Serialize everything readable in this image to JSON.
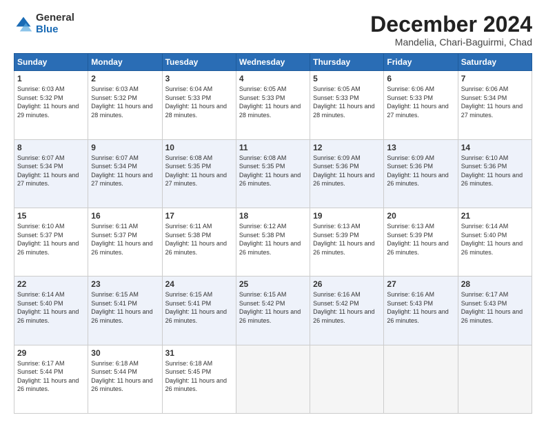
{
  "logo": {
    "general": "General",
    "blue": "Blue"
  },
  "title": "December 2024",
  "location": "Mandelia, Chari-Baguirmi, Chad",
  "days_of_week": [
    "Sunday",
    "Monday",
    "Tuesday",
    "Wednesday",
    "Thursday",
    "Friday",
    "Saturday"
  ],
  "weeks": [
    [
      {
        "day": "1",
        "rise": "6:03 AM",
        "set": "5:32 PM",
        "daylight": "11 hours and 29 minutes."
      },
      {
        "day": "2",
        "rise": "6:03 AM",
        "set": "5:32 PM",
        "daylight": "11 hours and 28 minutes."
      },
      {
        "day": "3",
        "rise": "6:04 AM",
        "set": "5:33 PM",
        "daylight": "11 hours and 28 minutes."
      },
      {
        "day": "4",
        "rise": "6:05 AM",
        "set": "5:33 PM",
        "daylight": "11 hours and 28 minutes."
      },
      {
        "day": "5",
        "rise": "6:05 AM",
        "set": "5:33 PM",
        "daylight": "11 hours and 28 minutes."
      },
      {
        "day": "6",
        "rise": "6:06 AM",
        "set": "5:33 PM",
        "daylight": "11 hours and 27 minutes."
      },
      {
        "day": "7",
        "rise": "6:06 AM",
        "set": "5:34 PM",
        "daylight": "11 hours and 27 minutes."
      }
    ],
    [
      {
        "day": "8",
        "rise": "6:07 AM",
        "set": "5:34 PM",
        "daylight": "11 hours and 27 minutes."
      },
      {
        "day": "9",
        "rise": "6:07 AM",
        "set": "5:34 PM",
        "daylight": "11 hours and 27 minutes."
      },
      {
        "day": "10",
        "rise": "6:08 AM",
        "set": "5:35 PM",
        "daylight": "11 hours and 27 minutes."
      },
      {
        "day": "11",
        "rise": "6:08 AM",
        "set": "5:35 PM",
        "daylight": "11 hours and 26 minutes."
      },
      {
        "day": "12",
        "rise": "6:09 AM",
        "set": "5:36 PM",
        "daylight": "11 hours and 26 minutes."
      },
      {
        "day": "13",
        "rise": "6:09 AM",
        "set": "5:36 PM",
        "daylight": "11 hours and 26 minutes."
      },
      {
        "day": "14",
        "rise": "6:10 AM",
        "set": "5:36 PM",
        "daylight": "11 hours and 26 minutes."
      }
    ],
    [
      {
        "day": "15",
        "rise": "6:10 AM",
        "set": "5:37 PM",
        "daylight": "11 hours and 26 minutes."
      },
      {
        "day": "16",
        "rise": "6:11 AM",
        "set": "5:37 PM",
        "daylight": "11 hours and 26 minutes."
      },
      {
        "day": "17",
        "rise": "6:11 AM",
        "set": "5:38 PM",
        "daylight": "11 hours and 26 minutes."
      },
      {
        "day": "18",
        "rise": "6:12 AM",
        "set": "5:38 PM",
        "daylight": "11 hours and 26 minutes."
      },
      {
        "day": "19",
        "rise": "6:13 AM",
        "set": "5:39 PM",
        "daylight": "11 hours and 26 minutes."
      },
      {
        "day": "20",
        "rise": "6:13 AM",
        "set": "5:39 PM",
        "daylight": "11 hours and 26 minutes."
      },
      {
        "day": "21",
        "rise": "6:14 AM",
        "set": "5:40 PM",
        "daylight": "11 hours and 26 minutes."
      }
    ],
    [
      {
        "day": "22",
        "rise": "6:14 AM",
        "set": "5:40 PM",
        "daylight": "11 hours and 26 minutes."
      },
      {
        "day": "23",
        "rise": "6:15 AM",
        "set": "5:41 PM",
        "daylight": "11 hours and 26 minutes."
      },
      {
        "day": "24",
        "rise": "6:15 AM",
        "set": "5:41 PM",
        "daylight": "11 hours and 26 minutes."
      },
      {
        "day": "25",
        "rise": "6:15 AM",
        "set": "5:42 PM",
        "daylight": "11 hours and 26 minutes."
      },
      {
        "day": "26",
        "rise": "6:16 AM",
        "set": "5:42 PM",
        "daylight": "11 hours and 26 minutes."
      },
      {
        "day": "27",
        "rise": "6:16 AM",
        "set": "5:43 PM",
        "daylight": "11 hours and 26 minutes."
      },
      {
        "day": "28",
        "rise": "6:17 AM",
        "set": "5:43 PM",
        "daylight": "11 hours and 26 minutes."
      }
    ],
    [
      {
        "day": "29",
        "rise": "6:17 AM",
        "set": "5:44 PM",
        "daylight": "11 hours and 26 minutes."
      },
      {
        "day": "30",
        "rise": "6:18 AM",
        "set": "5:44 PM",
        "daylight": "11 hours and 26 minutes."
      },
      {
        "day": "31",
        "rise": "6:18 AM",
        "set": "5:45 PM",
        "daylight": "11 hours and 26 minutes."
      },
      null,
      null,
      null,
      null
    ]
  ]
}
